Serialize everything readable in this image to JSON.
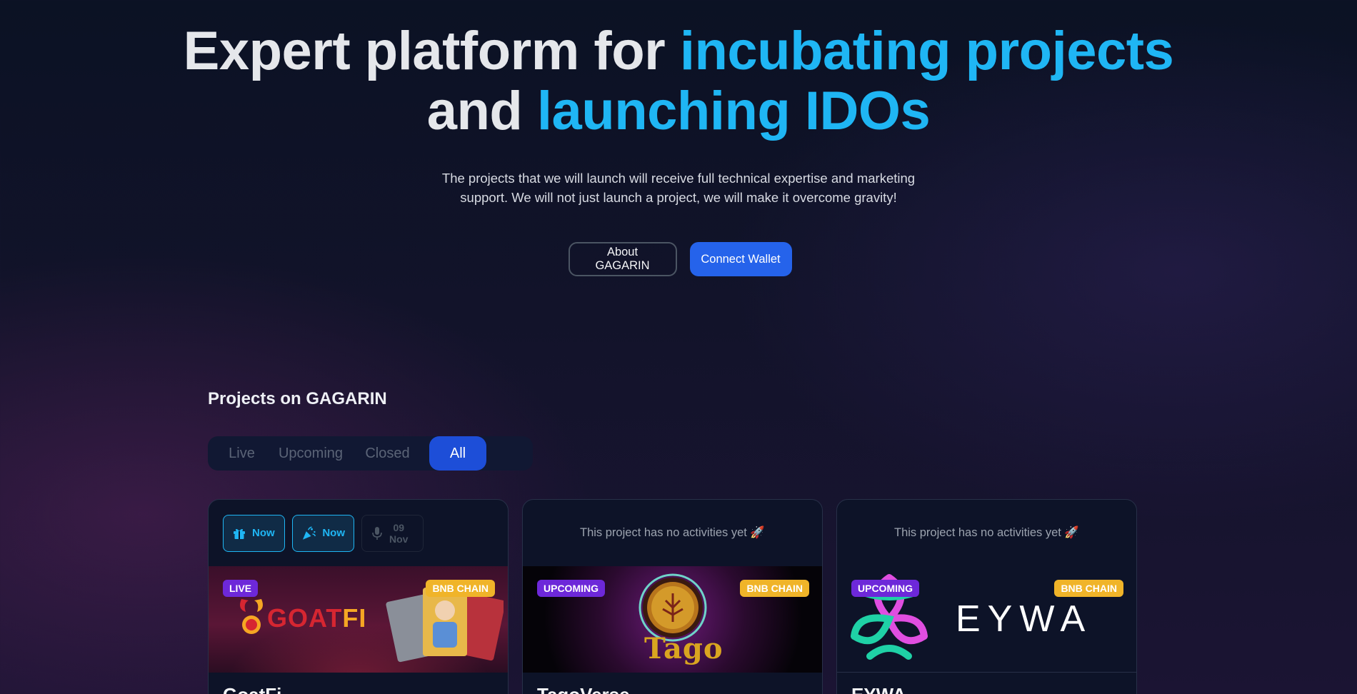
{
  "hero": {
    "title_line1_plain": "Expert platform for ",
    "title_line1_accent": "incubating projects",
    "title_line2_plain": "and ",
    "title_line2_accent": "launching IDOs",
    "subtitle_line1": "The projects that we will launch will receive full technical expertise and marketing",
    "subtitle_line2": "support. We will not just launch a project, we will make it overcome gravity!",
    "about_button": "About GAGARIN",
    "connect_button": "Connect Wallet"
  },
  "projects": {
    "section_title": "Projects on GAGARIN",
    "tabs": [
      "Live",
      "Upcoming",
      "Closed",
      "All"
    ],
    "active_tab": "All",
    "cards": [
      {
        "name": "GoatFi",
        "status": "LIVE",
        "chain": "BNB CHAIN",
        "logo_text_red": "GOAT",
        "logo_text_gold": "FI",
        "activities": [
          {
            "icon": "gift-icon",
            "label": "Now"
          },
          {
            "icon": "party-popper-icon",
            "label": "Now"
          },
          {
            "icon": "microphone-icon",
            "day": "09",
            "month": "Nov"
          }
        ]
      },
      {
        "name": "TagoVerse",
        "status": "UPCOMING",
        "chain": "BNB CHAIN",
        "no_activities": "This project has no activities yet 🚀",
        "logo_text": "Tago"
      },
      {
        "name": "EYWA",
        "status": "UPCOMING",
        "chain": "BNB CHAIN",
        "no_activities": "This project has no activities yet 🚀",
        "logo_text": "EYWA"
      }
    ]
  },
  "colors": {
    "accent": "#1fb6f4",
    "primary": "#2563eb",
    "status_badge": "#6d28d9",
    "chain_badge": "#f0b429"
  }
}
